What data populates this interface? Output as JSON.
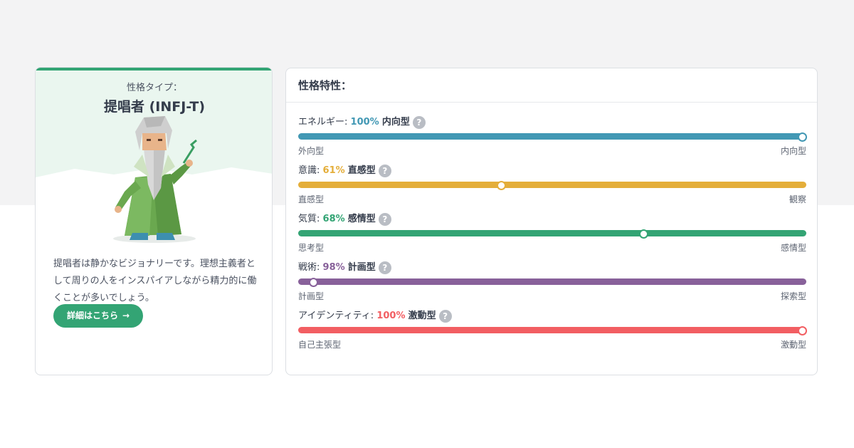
{
  "colors": {
    "accent": "#33a474",
    "energy": "#4298b4",
    "mind": "#e4ae3a",
    "nature": "#33a474",
    "tactics": "#88619a",
    "identity": "#f25e62"
  },
  "type_card": {
    "label": "性格タイプ：",
    "name": "提唱者 (INFJ-T)",
    "description": "提唱者は静かなビジョナリーです。理想主義者として周りの人をインスパイアしながら精力的に働くことが多いでしょう。",
    "button_label": "詳細はこちら",
    "button_icon": "arrow-right-icon"
  },
  "traits_card": {
    "title": "性格特性：",
    "traits": [
      {
        "name": "エネルギー",
        "percent": "100%",
        "kind": "内向型",
        "value": 1.0,
        "left": "外向型",
        "right": "内向型",
        "color": "#4298b4"
      },
      {
        "name": "意識",
        "percent": "61%",
        "kind": "直感型",
        "value": 0.4,
        "left": "直感型",
        "right": "観察",
        "color": "#e4ae3a"
      },
      {
        "name": "気質",
        "percent": "68%",
        "kind": "感情型",
        "value": 0.68,
        "left": "思考型",
        "right": "感情型",
        "color": "#33a474"
      },
      {
        "name": "戦術",
        "percent": "98%",
        "kind": "計画型",
        "value": 0.03,
        "left": "計画型",
        "right": "探索型",
        "color": "#88619a"
      },
      {
        "name": "アイデンティティ",
        "percent": "100%",
        "kind": "激動型",
        "value": 1.0,
        "left": "自己主張型",
        "right": "激動型",
        "color": "#f25e62"
      }
    ],
    "help_glyph": "?"
  }
}
